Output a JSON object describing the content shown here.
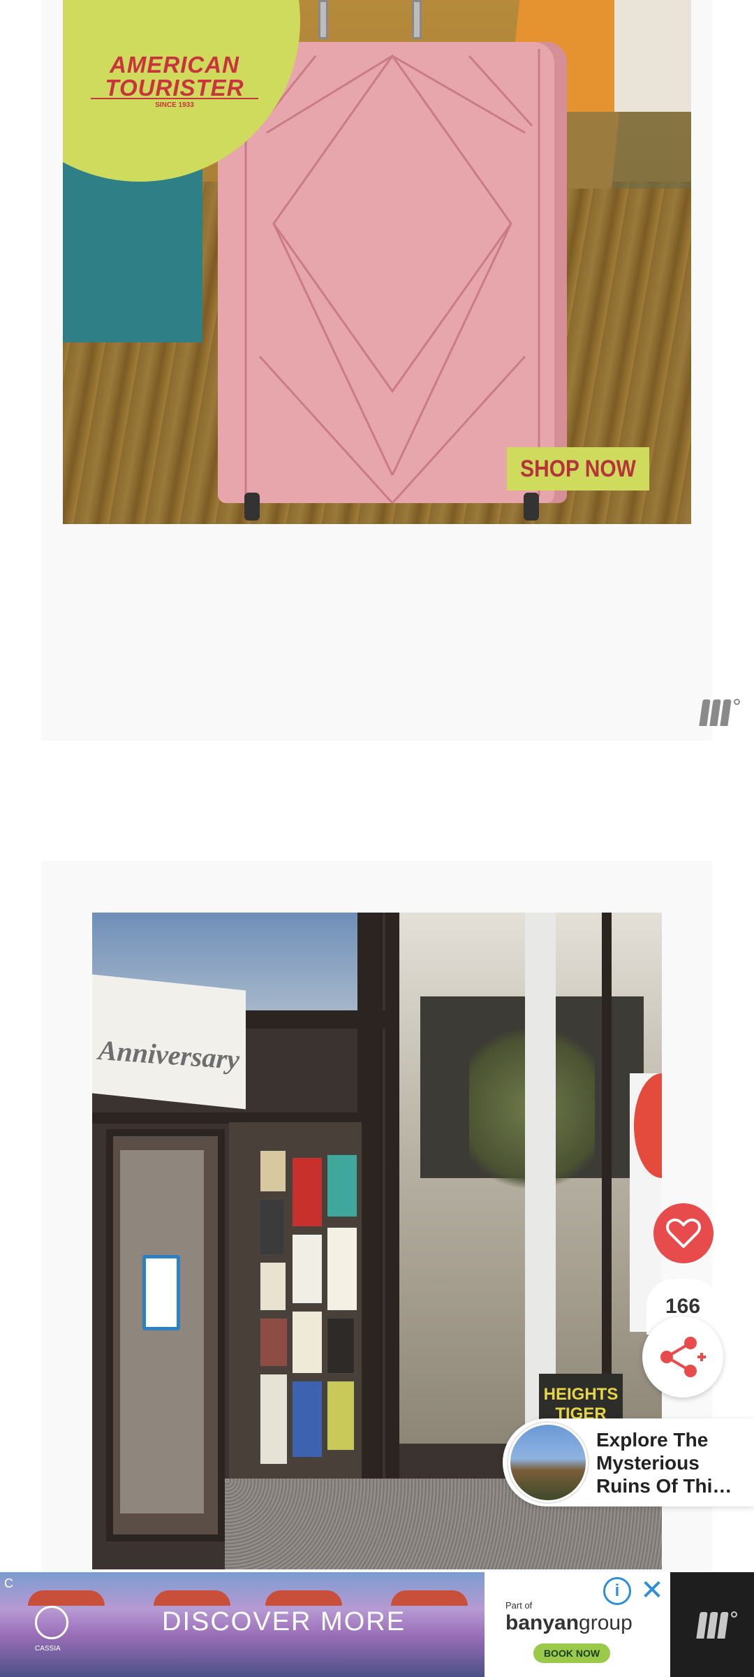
{
  "top_ad": {
    "brand_line1": "AMERICAN",
    "brand_line2": "TOURISTER",
    "since": "SINCE 1933",
    "cta": "SHOP NOW",
    "logo_icon": "ad-network-logo-icon"
  },
  "photo": {
    "banner_text": "Anniversary",
    "sign_text": "HEIGHTS TIGER"
  },
  "floating": {
    "like_icon": "heart-icon",
    "share_count": "166",
    "share_icon": "share-icon",
    "explore_title": "Explore The Mysterious Ruins Of Thi…",
    "explore_line1": "Explore The",
    "explore_line2": "Mysterious",
    "explore_line3": "Ruins Of Thi…"
  },
  "bottom_ad": {
    "corner_label": "C",
    "cta": "DISCOVER MORE",
    "cassia_label": "CASSIA",
    "part_of": "Part of",
    "group_name_bold": "banyan",
    "group_name_light": "group",
    "book_now": "BOOK NOW",
    "info_icon": "info-icon",
    "close_icon": "close-icon"
  },
  "colors": {
    "accent_red": "#e84b4b",
    "brand_lime": "#cedb5d",
    "brand_red": "#c9333d",
    "info_blue": "#2e8fd6"
  }
}
